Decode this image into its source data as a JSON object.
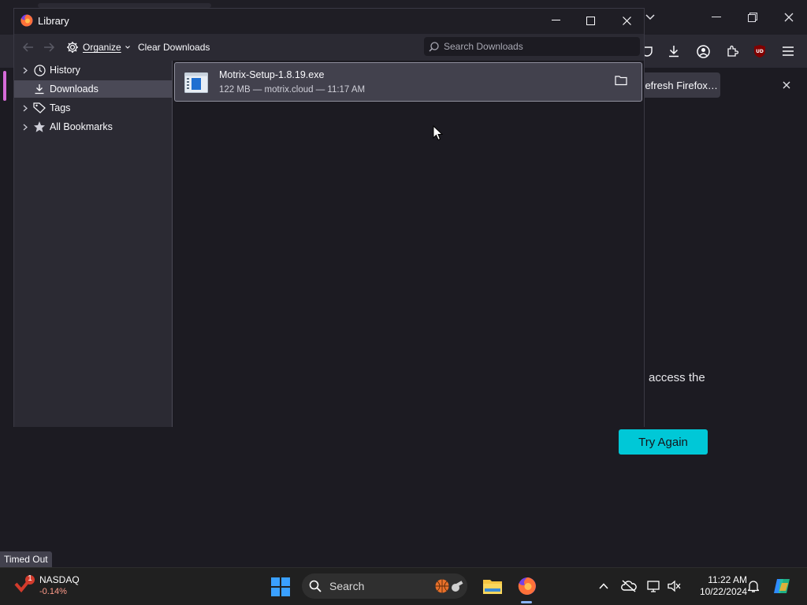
{
  "browser": {
    "refresh_label": "Refresh Firefox…",
    "error_text_fragment": "access the",
    "try_again_label": "Try Again",
    "status_text": "Timed Out"
  },
  "library": {
    "title": "Library",
    "toolbar": {
      "organize_label": "Organize",
      "clear_downloads_label": "Clear Downloads",
      "search_placeholder": "Search Downloads"
    },
    "sidebar": [
      {
        "label": "History",
        "icon": "clock-icon",
        "has_twisty": true
      },
      {
        "label": "Downloads",
        "icon": "download-icon",
        "has_twisty": false,
        "selected": true
      },
      {
        "label": "Tags",
        "icon": "tag-icon",
        "has_twisty": true
      },
      {
        "label": "All Bookmarks",
        "icon": "star-icon",
        "has_twisty": true
      }
    ],
    "downloads": [
      {
        "filename": "Motrix-Setup-1.8.19.exe",
        "meta": "122 MB — motrix.cloud — 11:17 AM"
      }
    ]
  },
  "taskbar": {
    "stock_name": "NASDAQ",
    "stock_change": "-0.14%",
    "stock_badge": "1",
    "search_label": "Search",
    "time": "11:22 AM",
    "date": "10/22/2024"
  },
  "colors": {
    "accent": "#00c8d7",
    "selected_row": "#42414d",
    "sidebar_bg": "#2b2a33",
    "window_bg": "#1c1b22"
  }
}
